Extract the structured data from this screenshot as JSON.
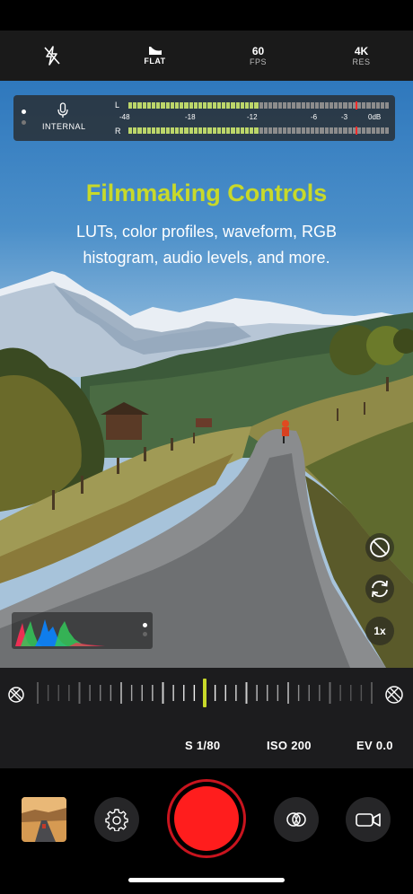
{
  "top_bar": {
    "flash_icon": "flash-off-icon",
    "profile": {
      "icon": "flat-profile-icon",
      "label": "FLAT"
    },
    "fps": {
      "value": "60",
      "label": "FPS"
    },
    "resolution": {
      "value": "4K",
      "label": "RES"
    }
  },
  "audio_meter": {
    "source_label": "INTERNAL",
    "channel_left": "L",
    "channel_right": "R",
    "scale": [
      "-48",
      "-18",
      "-12",
      "-6",
      "-3",
      "0dB"
    ],
    "level_left": 0.5,
    "level_right": 0.5,
    "colors": {
      "active": "#bcd66a",
      "inactive": "#8c8c8c",
      "peak": "#ff2a2a"
    }
  },
  "promo": {
    "title": "Filmmaking Controls",
    "subtitle": "LUTs, color profiles, waveform, RGB histogram, audio levels, and more.",
    "title_color": "#c8d92a"
  },
  "viewfinder_controls": {
    "disable_icon": "no-entry-icon",
    "flip_icon": "camera-flip-icon",
    "zoom": "1x"
  },
  "exposure": {
    "shutter": "S 1/80",
    "iso": "ISO 200",
    "ev": "EV 0.0",
    "indicator_color": "#c8d92a"
  },
  "bottom_bar": {
    "settings_icon": "gear-icon",
    "shutter_color": "#ff1d1d",
    "filters_icon": "overlapping-circles-icon",
    "mode_icon": "video-camera-icon"
  }
}
